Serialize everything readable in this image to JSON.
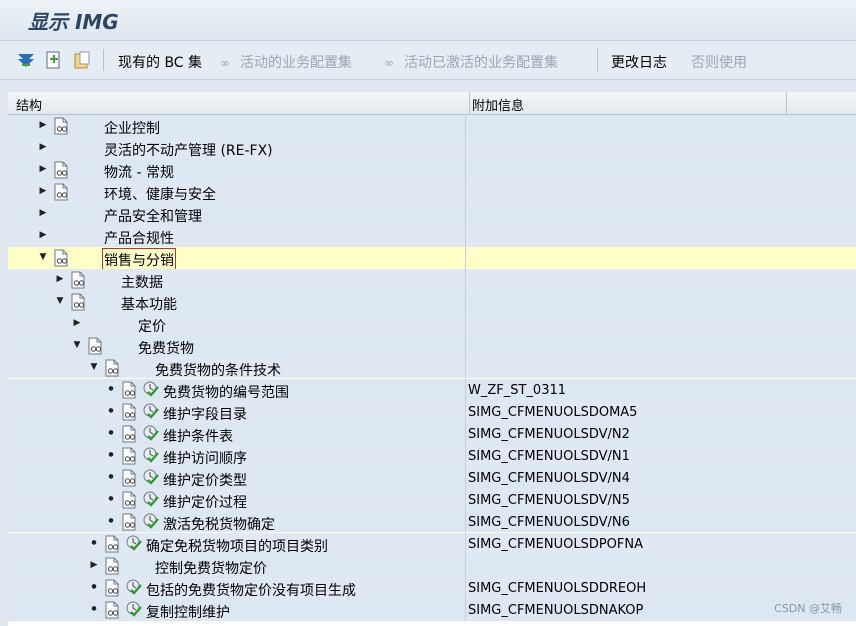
{
  "window": {
    "title": "显示 IMG"
  },
  "toolbar": {
    "bc_set": "现有的 BC 集",
    "active_bc_set": "活动的业务配置集",
    "activated_bc_set": "活动已激活的业务配置集",
    "change_log": "更改日志",
    "otherwise_use": "否则使用"
  },
  "grid": {
    "col_structure": "结构",
    "col_info": "附加信息",
    "rows": [
      {
        "label": "企业控制",
        "info": ""
      },
      {
        "label": "灵活的不动产管理 (RE-FX)",
        "info": ""
      },
      {
        "label": "物流 - 常规",
        "info": ""
      },
      {
        "label": "环境、健康与安全",
        "info": ""
      },
      {
        "label": "产品安全和管理",
        "info": ""
      },
      {
        "label": "产品合规性",
        "info": ""
      },
      {
        "label": "销售与分销",
        "info": ""
      },
      {
        "label": "主数据",
        "info": ""
      },
      {
        "label": "基本功能",
        "info": ""
      },
      {
        "label": "定价",
        "info": ""
      },
      {
        "label": "免费货物",
        "info": ""
      },
      {
        "label": "免费货物的条件技术",
        "info": ""
      },
      {
        "label": "免费货物的编号范围",
        "info": "W_ZF_ST_0311"
      },
      {
        "label": "维护字段目录",
        "info": "SIMG_CFMENUOLSDOMA5"
      },
      {
        "label": "维护条件表",
        "info": "SIMG_CFMENUOLSDV/N2"
      },
      {
        "label": "维护访问顺序",
        "info": "SIMG_CFMENUOLSDV/N1"
      },
      {
        "label": "维护定价类型",
        "info": "SIMG_CFMENUOLSDV/N4"
      },
      {
        "label": "维护定价过程",
        "info": "SIMG_CFMENUOLSDV/N5"
      },
      {
        "label": "激活免税货物确定",
        "info": "SIMG_CFMENUOLSDV/N6"
      },
      {
        "label": "确定免税货物项目的项目类别",
        "info": "SIMG_CFMENUOLSDPOFNA"
      },
      {
        "label": "控制免费货物定价",
        "info": ""
      },
      {
        "label": "包括的免费货物定价没有项目生成",
        "info": "SIMG_CFMENUOLSDDREOH"
      },
      {
        "label": "复制控制维护",
        "info": "SIMG_CFMENUOLSDNAKOP"
      }
    ]
  },
  "watermark": "CSDN @艾畅"
}
